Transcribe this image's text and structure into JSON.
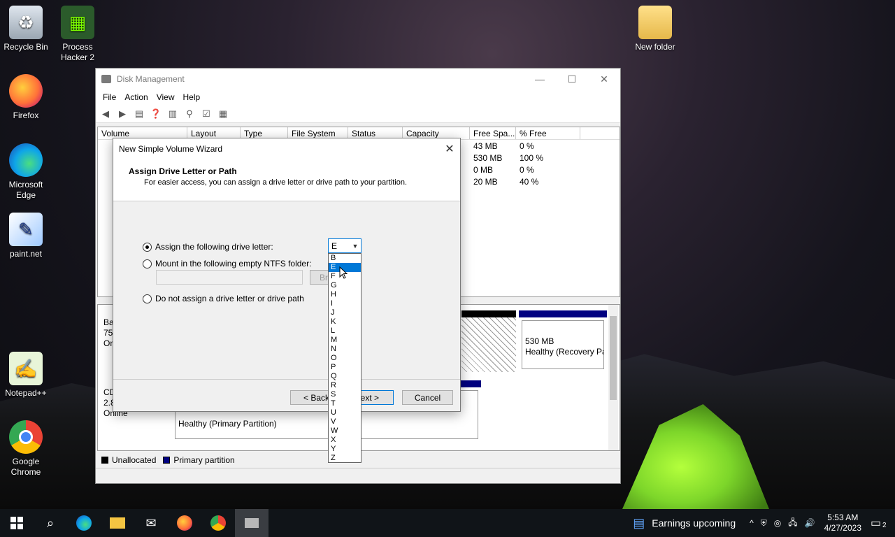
{
  "desktop": {
    "icons": [
      {
        "label": "Recycle Bin"
      },
      {
        "label": "Process Hacker 2"
      },
      {
        "label": "Firefox"
      },
      {
        "label": "Microsoft Edge"
      },
      {
        "label": "paint.net"
      },
      {
        "label": "Notepad++"
      },
      {
        "label": "Google Chrome"
      },
      {
        "label": "New folder"
      }
    ]
  },
  "disk_management": {
    "title": "Disk Management",
    "menu": [
      "File",
      "Action",
      "View",
      "Help"
    ],
    "columns": [
      "Volume",
      "Layout",
      "Type",
      "File System",
      "Status",
      "Capacity",
      "Free Spa...",
      "% Free"
    ],
    "rows": [
      {
        "free": "43 MB",
        "pct": "0 %"
      },
      {
        "free": "530 MB",
        "pct": "100 %"
      },
      {
        "free": "0 MB",
        "pct": "0 %"
      },
      {
        "free": "20 MB",
        "pct": "40 %"
      }
    ],
    "disk0": {
      "l1": "Ba",
      "l2": "75.",
      "l3": "On"
    },
    "cd": {
      "l1": "CD",
      "l2": "2.8",
      "l3": "Online"
    },
    "partition_recovery": {
      "size": "530 MB",
      "status": "Healthy (Recovery Pa"
    },
    "partition_primary_status": "Healthy (Primary Partition)",
    "legend": {
      "unallocated": "Unallocated",
      "primary": "Primary partition"
    }
  },
  "wizard": {
    "title": "New Simple Volume Wizard",
    "heading": "Assign Drive Letter or Path",
    "subheading": "For easier access, you can assign a drive letter or drive path to your partition.",
    "option_assign": "Assign the following drive letter:",
    "option_mount": "Mount in the following empty NTFS folder:",
    "option_none": "Do not assign a drive letter or drive path",
    "browse_label": "Bro",
    "selected_letter": "E",
    "letters": [
      "B",
      "E",
      "F",
      "G",
      "H",
      "I",
      "J",
      "K",
      "L",
      "M",
      "N",
      "O",
      "P",
      "Q",
      "R",
      "S",
      "T",
      "U",
      "V",
      "W",
      "X",
      "Y",
      "Z"
    ],
    "back_label": "< Back",
    "next_label": "ext >",
    "cancel_label": "Cancel"
  },
  "taskbar": {
    "weather": "Earnings upcoming",
    "time": "5:53 AM",
    "date": "4/27/2023",
    "notif_count": "2"
  }
}
